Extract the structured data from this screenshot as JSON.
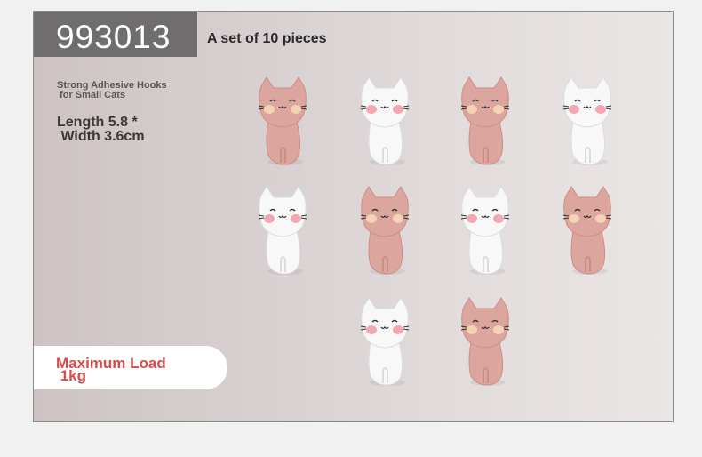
{
  "header": {
    "code": "993013",
    "headline": "A set of 10 pieces"
  },
  "info": {
    "subtitle": "Strong Adhesive Hooks\n for Small Cats",
    "size": "Length 5.8 *\n Width 3.6cm",
    "load": "Maximum Load\n 1kg"
  },
  "colors": {
    "pink_hook": "#dca69f",
    "white_hook": "#f8f8f8",
    "accent_text": "#d94a4a",
    "code_box": "#6f6d6d"
  },
  "hooks": [
    {
      "row": 1,
      "col": 1,
      "color": "pink"
    },
    {
      "row": 1,
      "col": 2,
      "color": "white"
    },
    {
      "row": 1,
      "col": 3,
      "color": "pink"
    },
    {
      "row": 1,
      "col": 4,
      "color": "white"
    },
    {
      "row": 2,
      "col": 1,
      "color": "white"
    },
    {
      "row": 2,
      "col": 2,
      "color": "pink"
    },
    {
      "row": 2,
      "col": 3,
      "color": "white"
    },
    {
      "row": 2,
      "col": 4,
      "color": "pink"
    },
    {
      "row": 3,
      "col": 2,
      "color": "white"
    },
    {
      "row": 3,
      "col": 3,
      "color": "pink"
    }
  ]
}
